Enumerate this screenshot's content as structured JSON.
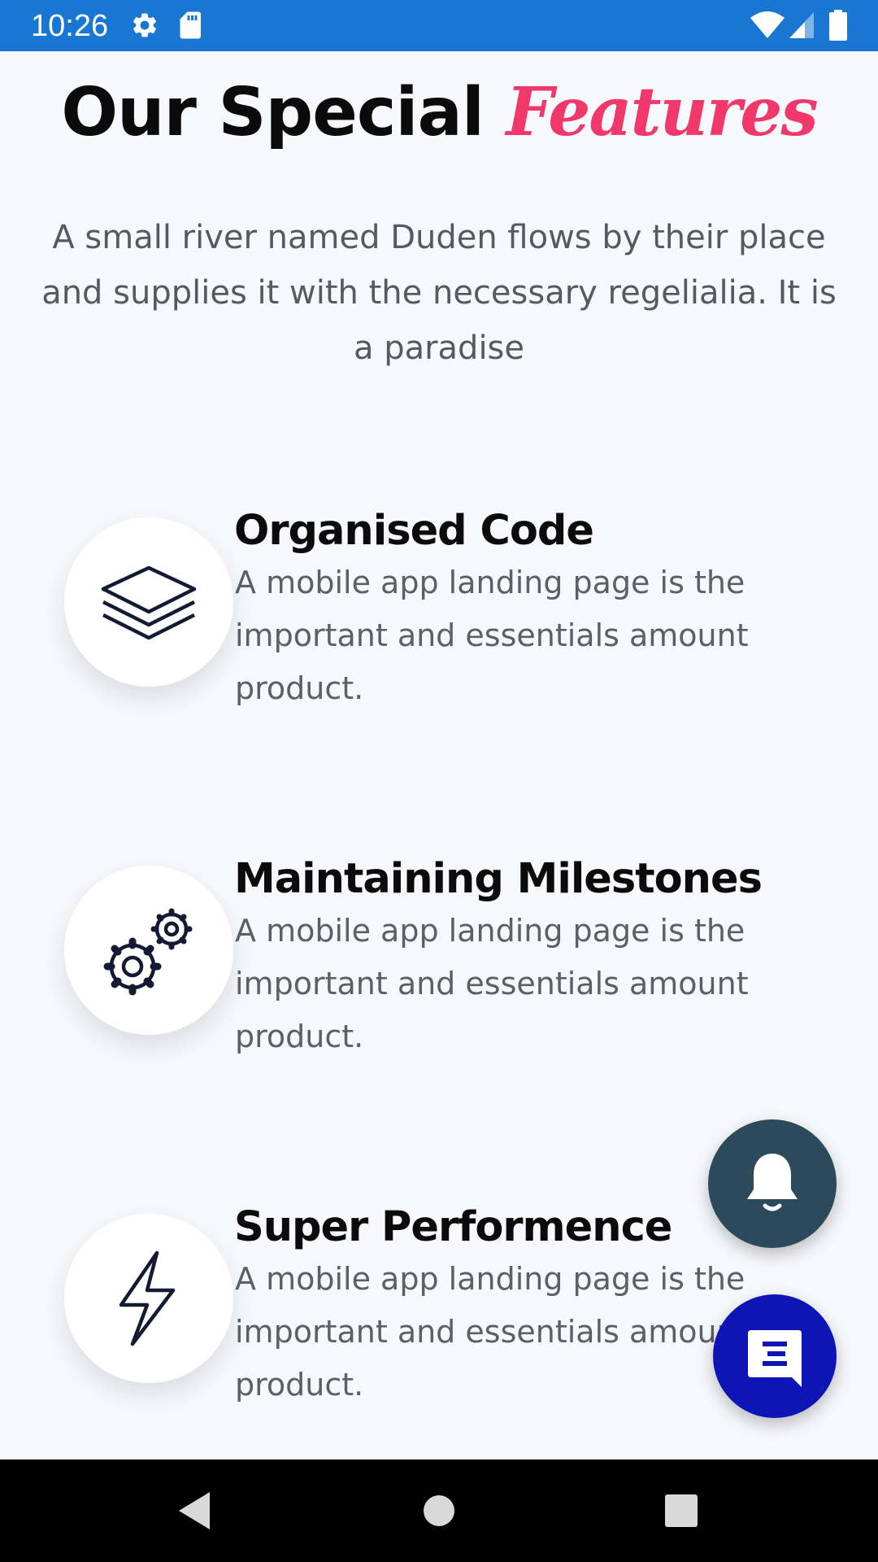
{
  "status_bar": {
    "time": "10:26",
    "background_color": "#1976d2",
    "left_icons": [
      "settings-gear-icon",
      "sd-card-icon"
    ],
    "right_icons": [
      "wifi-icon",
      "cell-signal-icon",
      "battery-icon"
    ]
  },
  "heading": {
    "title_main": "Our Special",
    "title_accent": "Features",
    "accent_color": "#f0386b",
    "intro": "A small river named Duden flows by their place and supplies it with the necessary regelialia. It is a paradise"
  },
  "features": [
    {
      "icon": "layers-icon",
      "title": "Organised Code",
      "description": "A mobile app landing page is the important and essentials amount product."
    },
    {
      "icon": "gears-icon",
      "title": "Maintaining Milestones",
      "description": "A mobile app landing page is the important and essentials amount product."
    },
    {
      "icon": "lightning-bolt-icon",
      "title": "Super Performence",
      "description": "A mobile app landing page is the important and essentials amount product."
    }
  ],
  "floating_buttons": {
    "notification": {
      "icon": "bell-icon",
      "color": "#2c4a5b"
    },
    "chat": {
      "icon": "chat-icon",
      "color": "#0d15b7"
    }
  },
  "nav_bar": {
    "buttons": [
      "back-icon",
      "home-icon",
      "recents-icon"
    ]
  }
}
